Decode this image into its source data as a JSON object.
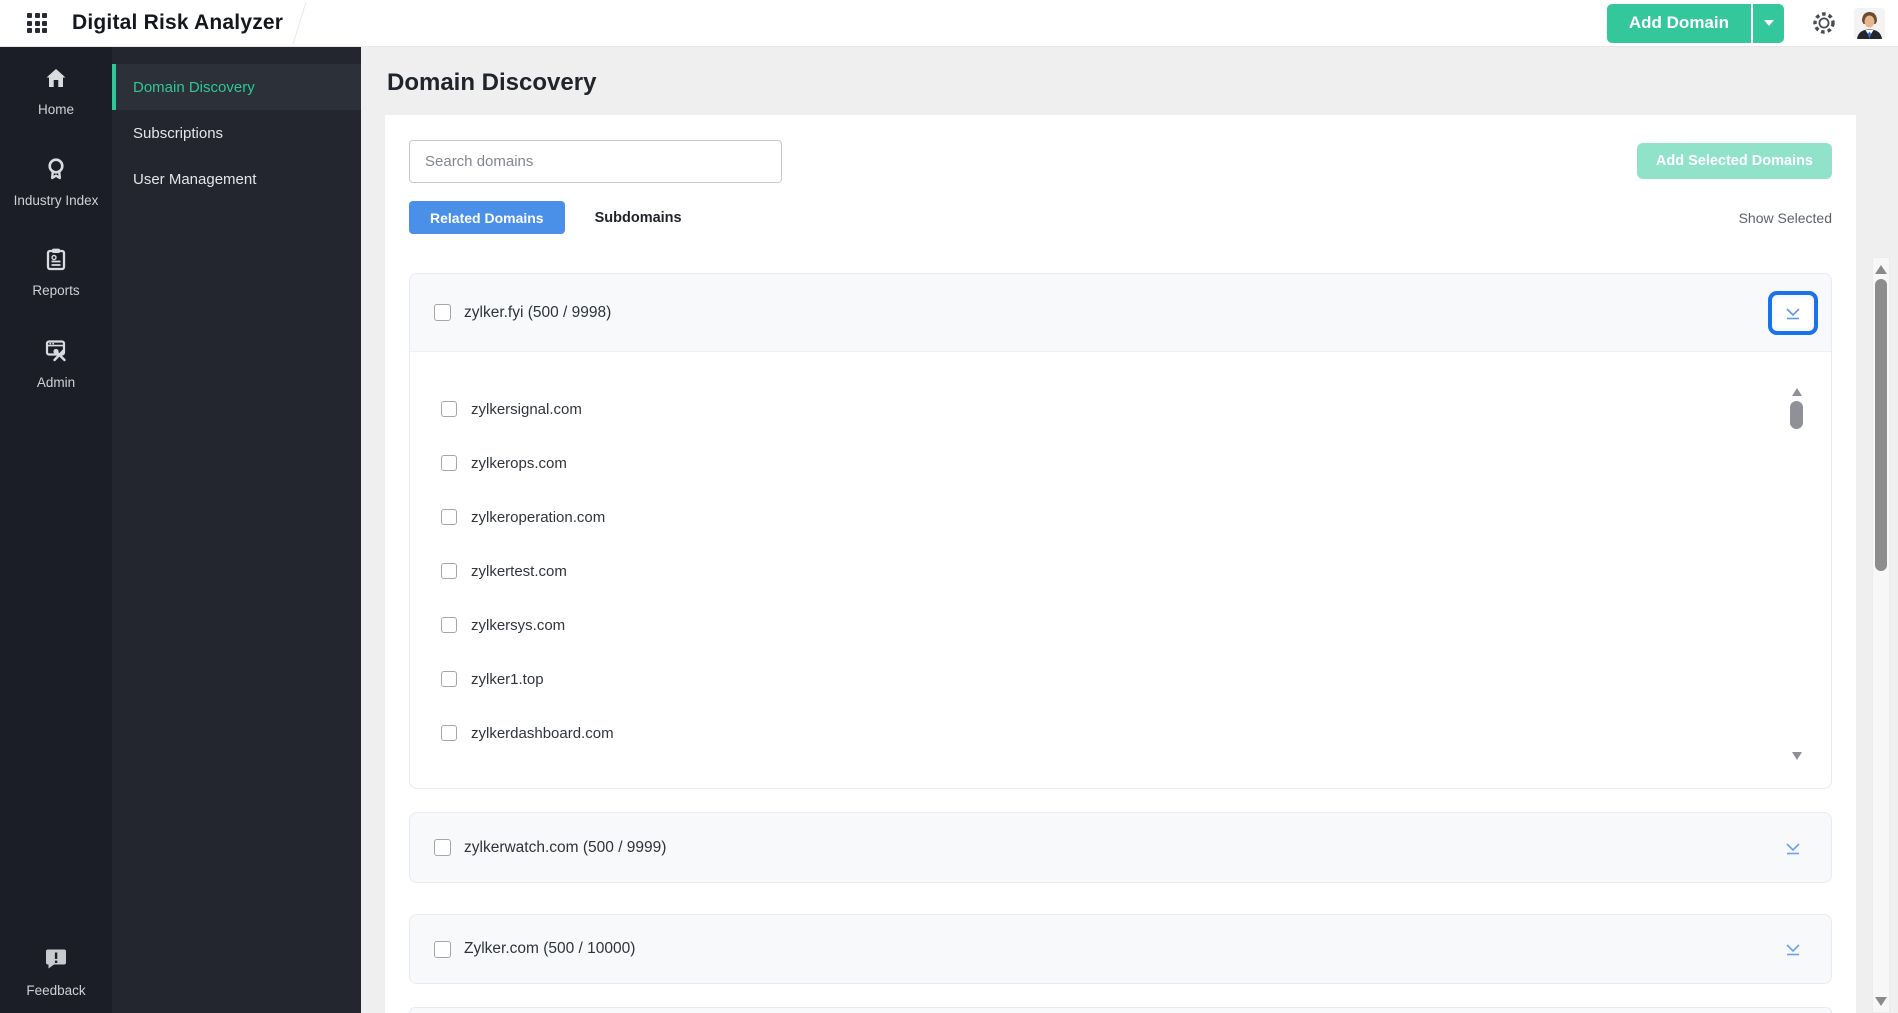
{
  "topbar": {
    "app_title": "Digital Risk Analyzer",
    "add_domain_label": "Add Domain"
  },
  "sidebar": {
    "items": [
      {
        "label": "Home"
      },
      {
        "label": "Industry Index"
      },
      {
        "label": "Reports"
      },
      {
        "label": "Admin"
      }
    ],
    "feedback_label": "Feedback"
  },
  "subnav": {
    "items": [
      {
        "label": "Domain Discovery",
        "active": true
      },
      {
        "label": "Subscriptions",
        "active": false
      },
      {
        "label": "User Management",
        "active": false
      }
    ]
  },
  "main": {
    "page_title": "Domain Discovery",
    "search_placeholder": "Search domains",
    "search_value": "",
    "add_selected_label": "Add Selected Domains",
    "tabs": [
      {
        "label": "Related Domains",
        "active": true
      },
      {
        "label": "Subdomains",
        "active": false
      }
    ],
    "show_selected_label": "Show Selected",
    "groups": [
      {
        "label": "zylker.fyi (500 / 9998)",
        "checked": false,
        "expanded": true,
        "children": [
          "zylkersignal.com",
          "zylkerops.com",
          "zylkeroperation.com",
          "zylkertest.com",
          "zylkersys.com",
          "zylker1.top",
          "zylkerdashboard.com"
        ]
      },
      {
        "label": "zylkerwatch.com (500 / 9999)",
        "checked": false,
        "expanded": false
      },
      {
        "label": "Zylker.com (500 / 10000)",
        "checked": false,
        "expanded": false
      }
    ]
  },
  "icons": {
    "topbar": [
      "apps-grid-icon",
      "caret-down-icon",
      "gear-icon",
      "user-avatar"
    ],
    "sidebar": [
      "home-icon",
      "medal-icon",
      "clipboard-icon",
      "browser-tools-icon",
      "feedback-bubble-icon"
    ],
    "cards": [
      "checkbox",
      "chevron-collapse-icon"
    ]
  },
  "colors": {
    "accent_teal": "#35c79c",
    "accent_teal_disabled": "#90e2c8",
    "tab_active_blue": "#4a90e8",
    "focus_ring_blue": "#1a73e8",
    "subnav_active_text": "#2fc795",
    "chevron_blue": "#5f97ec",
    "sidebar_dark": "#1b1e26",
    "subnav_dark": "#23262e"
  }
}
